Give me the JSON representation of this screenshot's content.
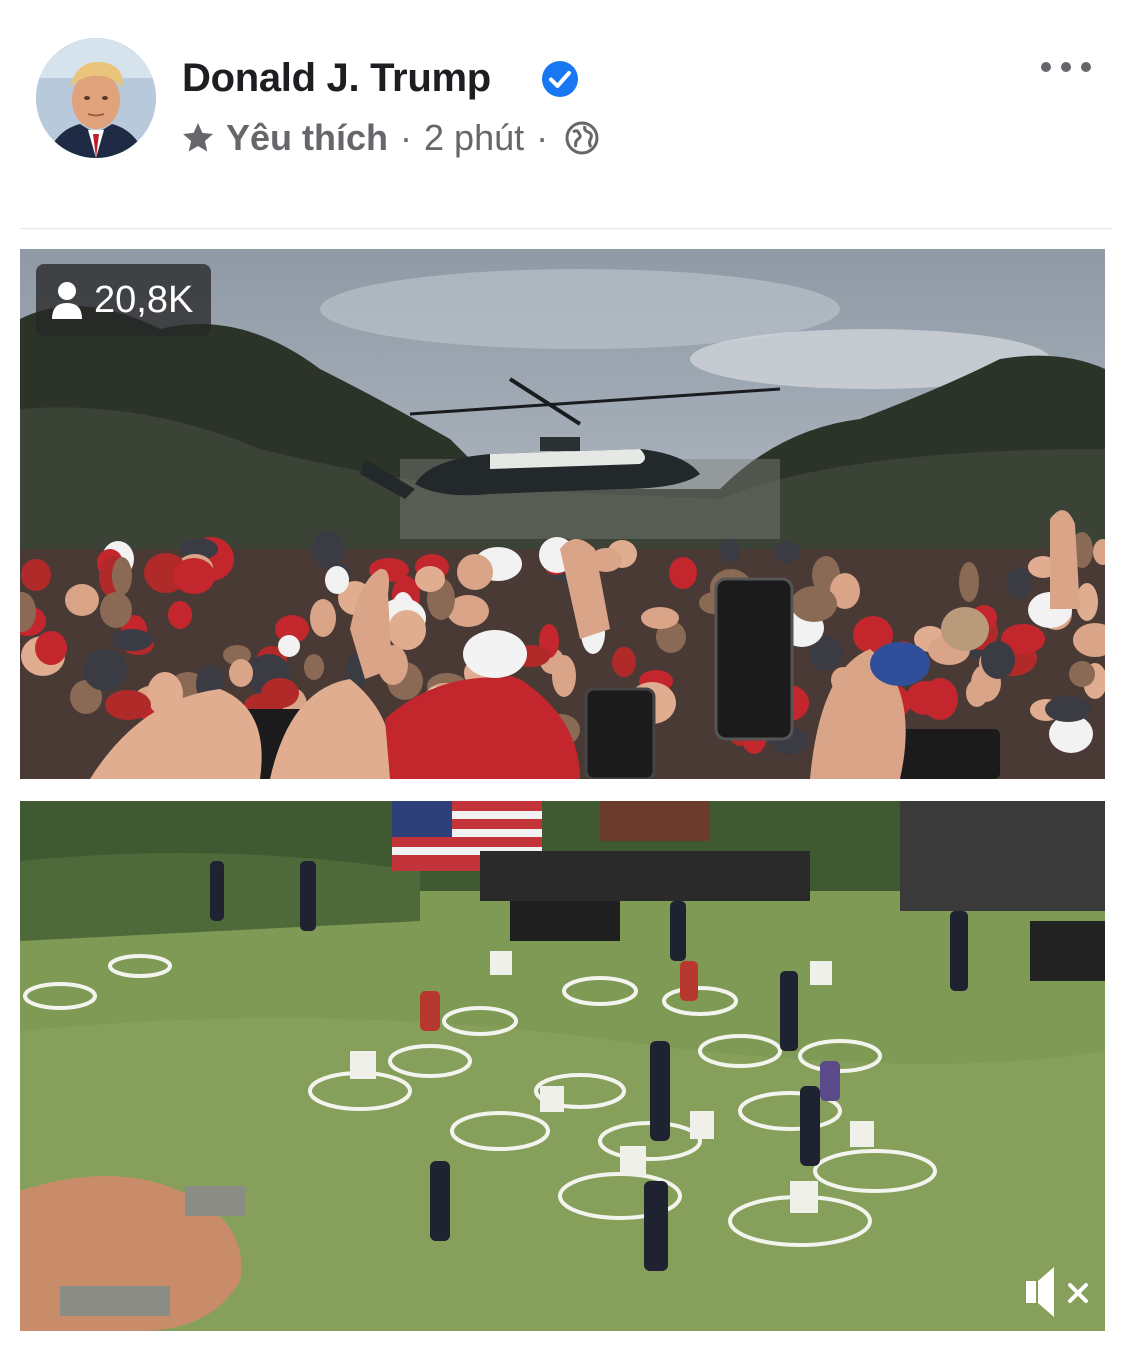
{
  "post": {
    "author": "Donald J. Trump",
    "verified": true,
    "meta": {
      "favorite_label": "Yêu thích",
      "separator": "·",
      "time": "2 phút"
    },
    "icons": {
      "star": "star-icon",
      "globe": "globe-icon",
      "verified": "verified-badge-icon",
      "more": "more-options-icon"
    }
  },
  "video": {
    "view_count": "20,8K",
    "icons": {
      "viewer": "person-icon",
      "mute": "mute-icon"
    }
  },
  "colors": {
    "verified_blue": "#1877f2",
    "meta_gray": "#65676b",
    "name_black": "#1c1e21"
  }
}
